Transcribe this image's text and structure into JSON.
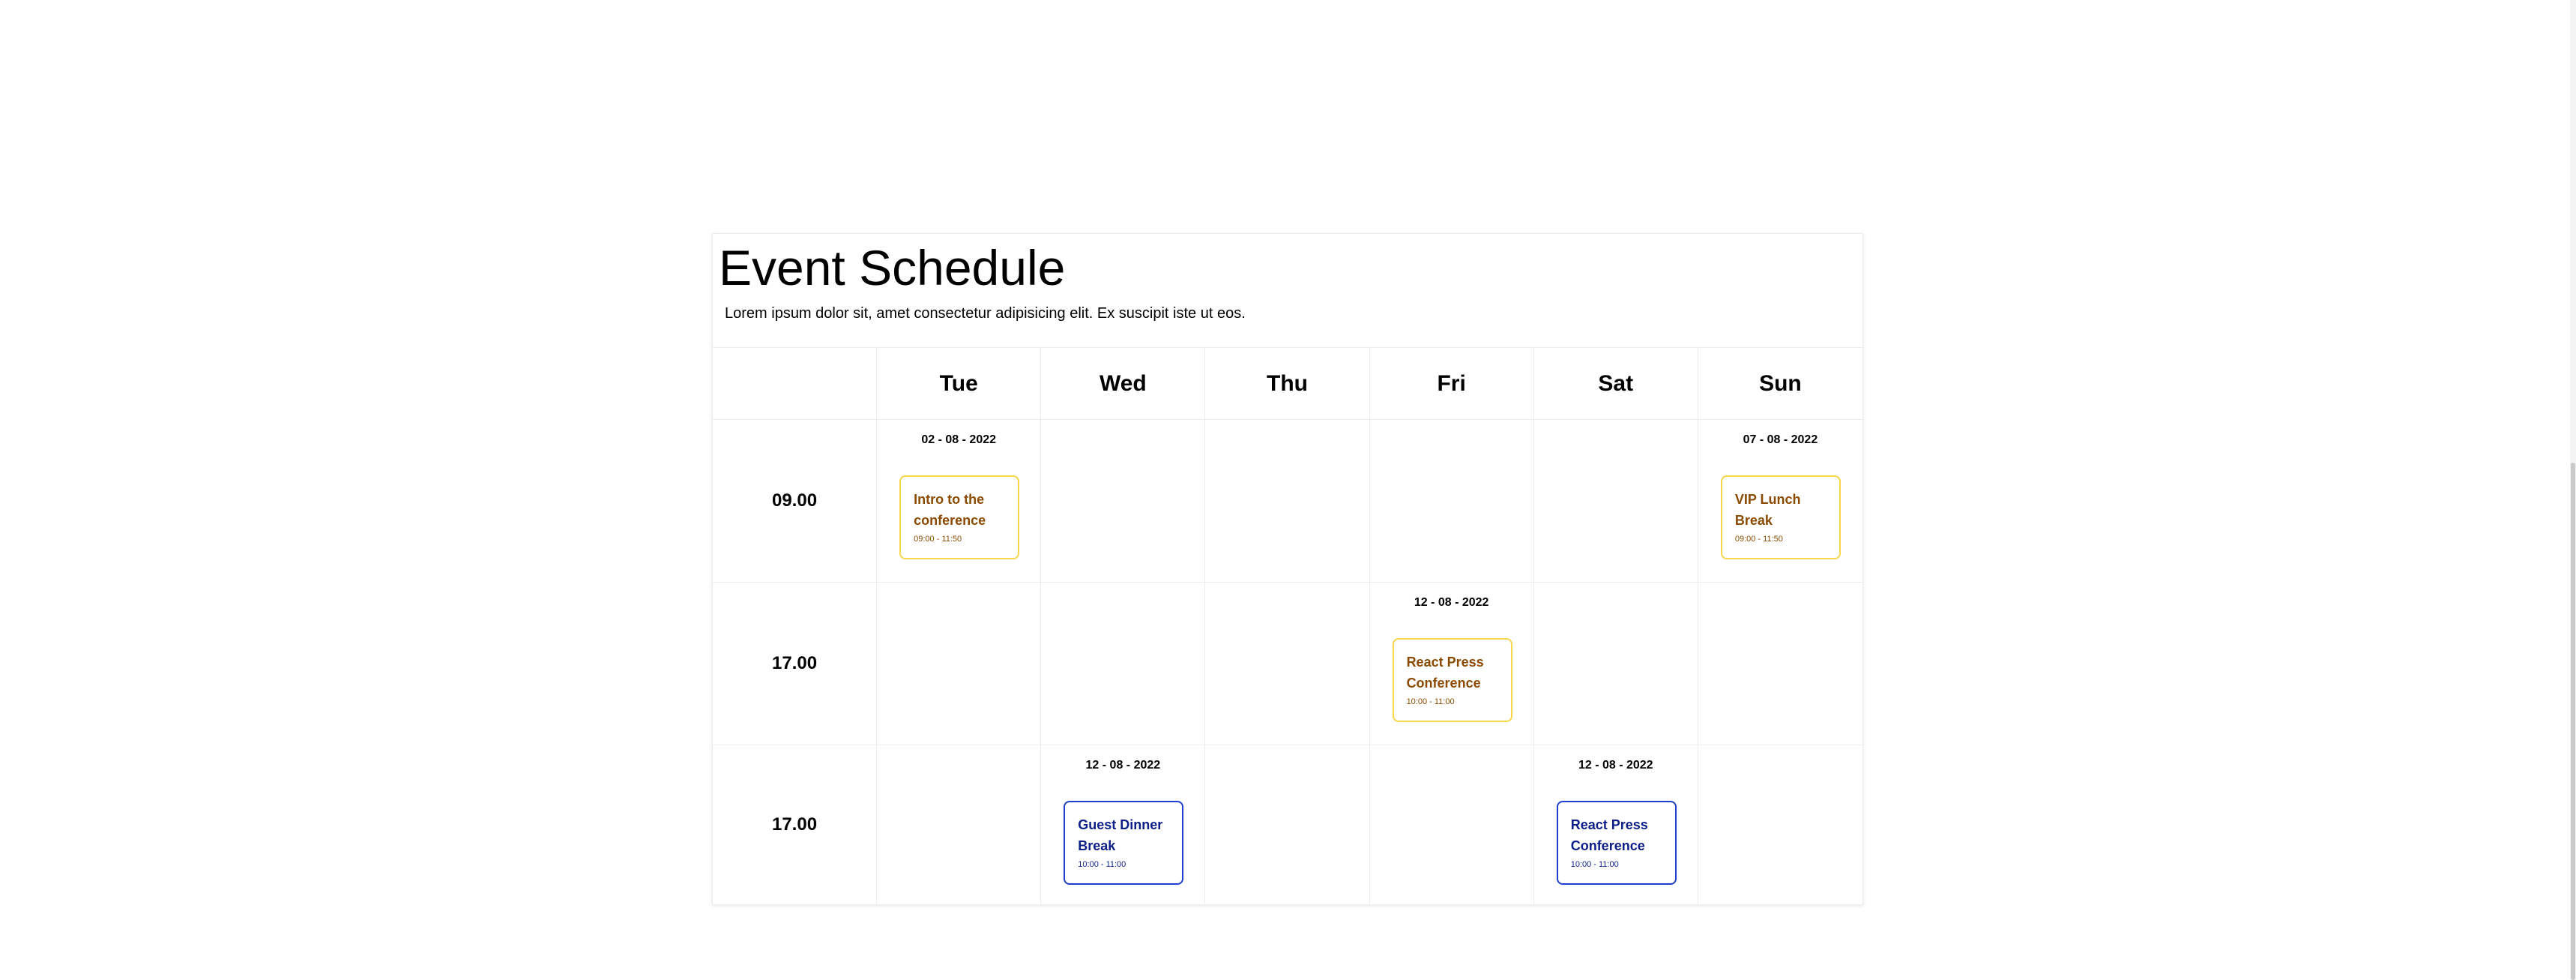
{
  "header": {
    "title": "Event Schedule",
    "subtitle": "Lorem ipsum dolor sit, amet consectetur adipisicing elit. Ex suscipit iste ut eos."
  },
  "days": [
    "Tue",
    "Wed",
    "Thu",
    "Fri",
    "Sat",
    "Sun"
  ],
  "rows": [
    {
      "time": "09.00",
      "events": [
        {
          "date": "02 - 08 - 2022",
          "name": "Intro to the conference",
          "time": "09:00 - 11:50",
          "color": "#f8d74a"
        },
        null,
        null,
        null,
        null,
        {
          "date": "07 - 08 - 2022",
          "name": "VIP Lunch Break",
          "time": "09:00 - 11:50",
          "color": "#f8d74a"
        }
      ]
    },
    {
      "time": "17.00",
      "events": [
        null,
        null,
        null,
        {
          "date": "12 - 08 - 2022",
          "name": "React Press Conference",
          "time": "10:00 - 11:00",
          "color": "#f8d74a"
        },
        null,
        null
      ]
    },
    {
      "time": "17.00",
      "events": [
        null,
        {
          "date": "12 - 08 - 2022",
          "name": "Guest Dinner Break",
          "time": "10:00 - 11:00",
          "color": "#1e3fd0"
        },
        null,
        null,
        {
          "date": "12 - 08 - 2022",
          "name": "React Press Conference",
          "time": "10:00 - 11:00",
          "color": "#1e3fd0"
        },
        null
      ]
    }
  ]
}
